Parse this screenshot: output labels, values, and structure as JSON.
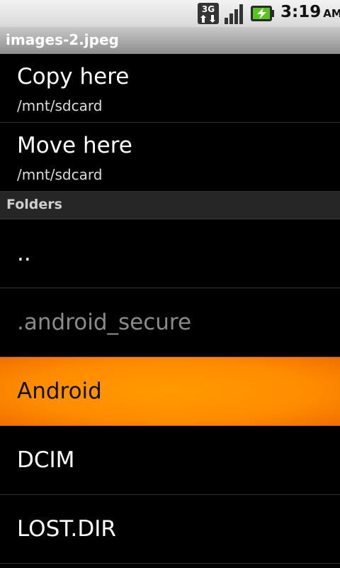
{
  "status_bar": {
    "network_label": "3G",
    "time": "3:19",
    "ampm": "AM",
    "icons": [
      "network-3g-icon",
      "signal-strength-icon",
      "battery-charging-icon"
    ]
  },
  "title": "images-2.jpeg",
  "actions": [
    {
      "label": "Copy here",
      "path": "/mnt/sdcard"
    },
    {
      "label": "Move here",
      "path": "/mnt/sdcard"
    }
  ],
  "section_header": "Folders",
  "folders": [
    {
      "name": ".."
    },
    {
      "name": ".android_secure",
      "state": "disabled"
    },
    {
      "name": "Android",
      "state": "selected"
    },
    {
      "name": "DCIM"
    },
    {
      "name": "LOST.DIR"
    }
  ],
  "colors": {
    "selected_highlight": "#ff8c00",
    "background": "#000000",
    "disabled_text": "#8a8a8a"
  }
}
